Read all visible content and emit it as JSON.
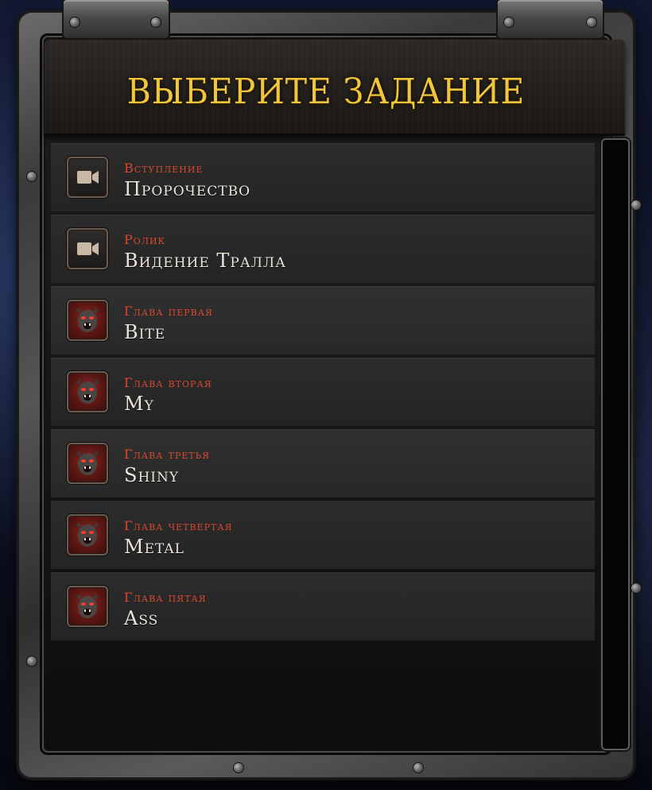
{
  "dialog": {
    "title": "ВЫБЕРИТЕ ЗАДАНИЕ"
  },
  "missions": [
    {
      "kind": "Вступление",
      "name": "Пророчество",
      "icon": "cinematic-camera-icon"
    },
    {
      "kind": "Ролик",
      "name": "Видение Тралла",
      "icon": "cinematic-camera-icon"
    },
    {
      "kind": "Глава первая",
      "name": "Bite",
      "icon": "orc-chapter-icon"
    },
    {
      "kind": "Глава вторая",
      "name": "My",
      "icon": "orc-chapter-icon"
    },
    {
      "kind": "Глава третья",
      "name": "Shiny",
      "icon": "orc-chapter-icon"
    },
    {
      "kind": "Глава четвертая",
      "name": "Metal",
      "icon": "orc-chapter-icon"
    },
    {
      "kind": "Глава пятая",
      "name": "Ass",
      "icon": "orc-chapter-icon"
    }
  ],
  "colors": {
    "title": "#f2c63a",
    "kind": "#d9482f",
    "name": "#ebe6dc"
  }
}
